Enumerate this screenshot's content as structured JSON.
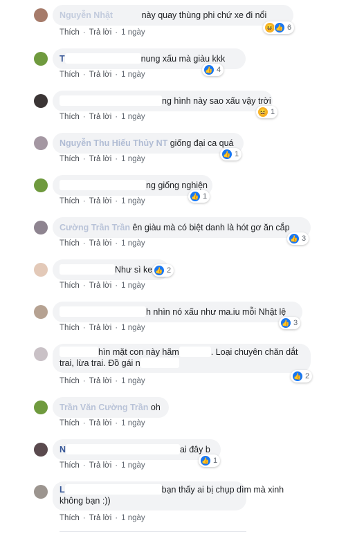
{
  "actions": {
    "like": "Thích",
    "reply": "Trả lời",
    "time": "1 ngày"
  },
  "comments": [
    {
      "name": "Nguyễn Nhật",
      "text": "này quay thùng phi chứ xe đi nổi",
      "reactions": {
        "types": [
          "haha",
          "like"
        ],
        "count": "6"
      }
    },
    {
      "name": "T",
      "text": "nung xấu mà giàu kkk",
      "reactions": {
        "types": [
          "like"
        ],
        "count": "4"
      }
    },
    {
      "name": "",
      "text": "ng hình này sao xấu vậy trời",
      "reactions": {
        "types": [
          "haha"
        ],
        "count": "1"
      }
    },
    {
      "name": "Nguyễn Thu Hiếu Thủy NT",
      "text": "giống đại ca quá",
      "reactions": {
        "types": [
          "like"
        ],
        "count": "1"
      }
    },
    {
      "name": "",
      "text": "ng giống nghiện",
      "reactions": {
        "types": [
          "like"
        ],
        "count": "1"
      }
    },
    {
      "name": "Cường Trần Trần",
      "text": "ên giàu mà có biệt danh là hót gơ ăn cắp",
      "reactions": {
        "types": [
          "like"
        ],
        "count": "3"
      }
    },
    {
      "name": "",
      "text": "Như sì ke",
      "reactions": {
        "types": [
          "like"
        ],
        "count": "2"
      }
    },
    {
      "name": "",
      "text": "h nhìn nó xấu như ma.iu mỗi Nhật lệ",
      "reactions": {
        "types": [
          "like"
        ],
        "count": "3"
      }
    },
    {
      "name": "",
      "text_line1": "hìn mặt con này hãm",
      "text_line1b": ". Loại chuyên chăn dắt",
      "text_line2": "trai, lừa trai. Đồ gái n",
      "reactions": {
        "types": [
          "like"
        ],
        "count": "2"
      }
    },
    {
      "name": "Trần Văn Cường Trần",
      "text": "oh"
    },
    {
      "name": "N",
      "text": "ai đây b",
      "reactions": {
        "types": [
          "like"
        ],
        "count": "1"
      }
    },
    {
      "name": "L",
      "text_line1": "bạn thấy ai bị chụp dìm mà xinh",
      "text_line2": "không bạn :))"
    }
  ]
}
